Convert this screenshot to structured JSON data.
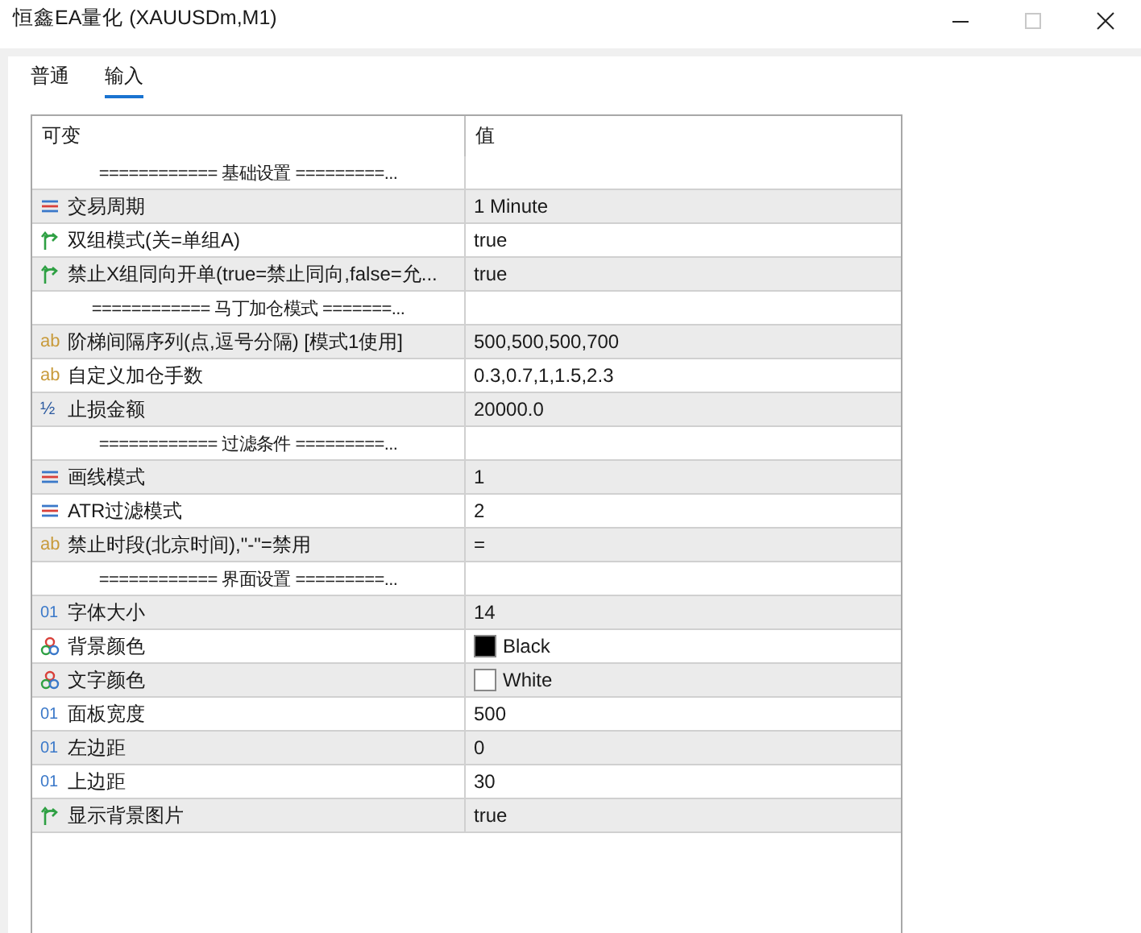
{
  "window": {
    "title": "恒鑫EA量化 (XAUUSDm,M1)"
  },
  "tabs": [
    {
      "label": "普通",
      "selected": false
    },
    {
      "label": "输入",
      "selected": true
    }
  ],
  "table": {
    "columns": [
      "可变",
      "值"
    ],
    "rows": [
      {
        "kind": "separator",
        "name": "============ 基础设置 =========..."
      },
      {
        "kind": "enum",
        "name": "交易周期",
        "value": "1 Minute"
      },
      {
        "kind": "bool",
        "name": "双组模式(关=单组A)",
        "value": "true"
      },
      {
        "kind": "bool",
        "name": "禁止X组同向开单(true=禁止同向,false=允...",
        "value": "true"
      },
      {
        "kind": "separator",
        "name": "============ 马丁加仓模式 =======..."
      },
      {
        "kind": "string",
        "icon": "ab",
        "name": "阶梯间隔序列(点,逗号分隔) [模式1使用]",
        "value": "500,500,500,700"
      },
      {
        "kind": "string",
        "icon": "ab",
        "name": "自定义加仓手数",
        "value": "0.3,0.7,1,1.5,2.3"
      },
      {
        "kind": "double",
        "icon": "½",
        "name": "止损金额",
        "value": "20000.0"
      },
      {
        "kind": "separator",
        "name": "============ 过滤条件 =========..."
      },
      {
        "kind": "enum",
        "name": "画线模式",
        "value": "1"
      },
      {
        "kind": "enum",
        "name": "ATR过滤模式",
        "value": "2"
      },
      {
        "kind": "string",
        "icon": "ab",
        "name": "禁止时段(北京时间),\"-\"=禁用",
        "value": "="
      },
      {
        "kind": "separator",
        "name": "============ 界面设置 =========..."
      },
      {
        "kind": "int",
        "icon": "01",
        "name": "字体大小",
        "value": "14"
      },
      {
        "kind": "color",
        "name": "背景颜色",
        "value": "Black",
        "color": "#000000"
      },
      {
        "kind": "color",
        "name": "文字颜色",
        "value": "White",
        "color": "#ffffff"
      },
      {
        "kind": "int",
        "icon": "01",
        "name": "面板宽度",
        "value": "500"
      },
      {
        "kind": "int",
        "icon": "01",
        "name": "左边距",
        "value": "0"
      },
      {
        "kind": "int",
        "icon": "01",
        "name": "上边距",
        "value": "30"
      },
      {
        "kind": "bool",
        "name": "显示背景图片",
        "value": "true"
      }
    ]
  }
}
